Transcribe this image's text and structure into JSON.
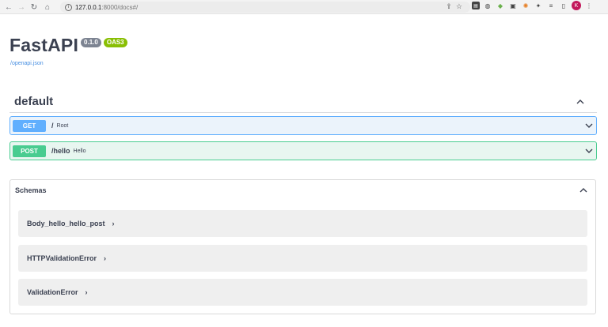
{
  "browser": {
    "back_icon": "arrow-left",
    "forward_icon": "arrow-right",
    "reload_icon": "reload",
    "home_icon": "home",
    "url_host": "127.0.0.1",
    "url_rest": ":8000/docs#/",
    "avatar_letter": "K"
  },
  "page": {
    "title": "FastAPI",
    "version": "0.1.0",
    "oas_badge": "OAS3",
    "spec_link": "/openapi.json"
  },
  "tag": {
    "name": "default"
  },
  "operations": [
    {
      "method": "GET",
      "path": "/",
      "summary": "Root",
      "color": "#61affe"
    },
    {
      "method": "POST",
      "path": "/hello",
      "summary": "Hello",
      "color": "#49cc90"
    }
  ],
  "schemas": {
    "header": "Schemas",
    "models": [
      {
        "name": "Body_hello_hello_post",
        "arrow": "›"
      },
      {
        "name": "HTTPValidationError",
        "arrow": "›"
      },
      {
        "name": "ValidationError",
        "arrow": "›"
      }
    ]
  }
}
